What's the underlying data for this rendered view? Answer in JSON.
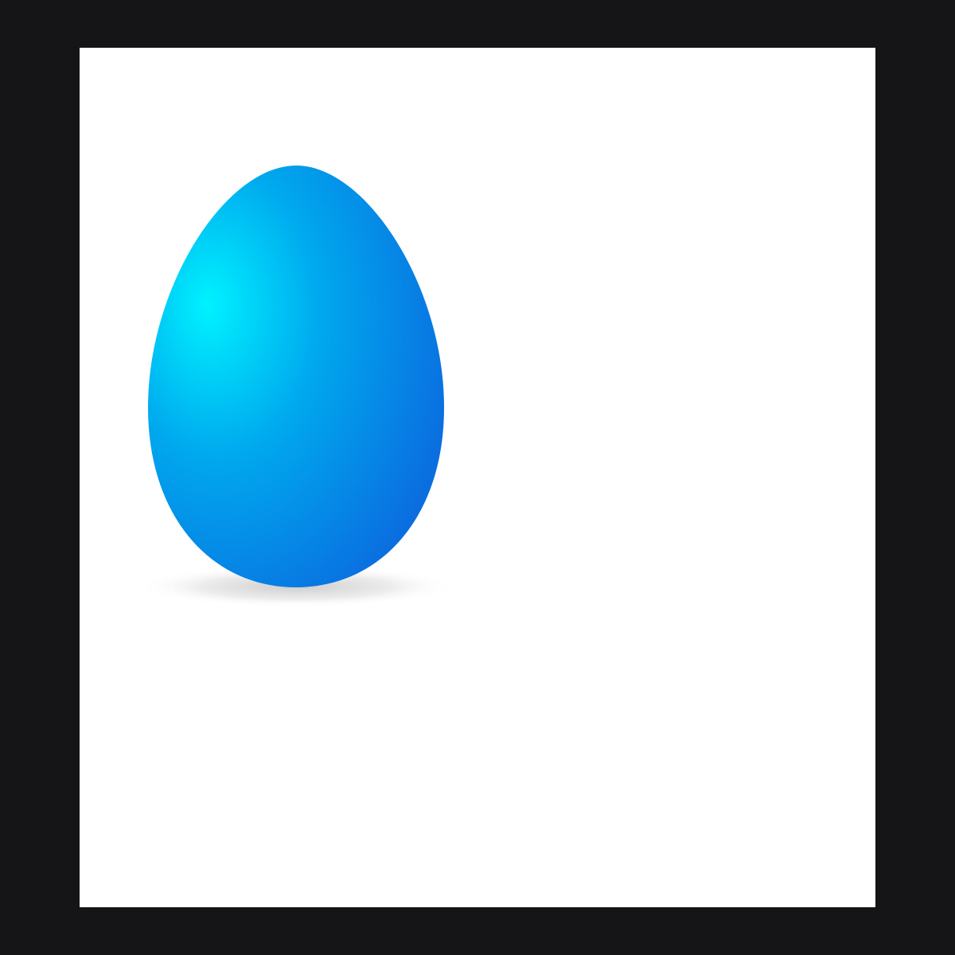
{
  "canvas": {
    "border_color": "#151517",
    "background_color": "#ffffff"
  },
  "egg": {
    "highlight_color": "#00f2ff",
    "mid_color": "#00a8ee",
    "edge_color": "#0a6ee0",
    "shadow_color": "#c9c9c9"
  }
}
